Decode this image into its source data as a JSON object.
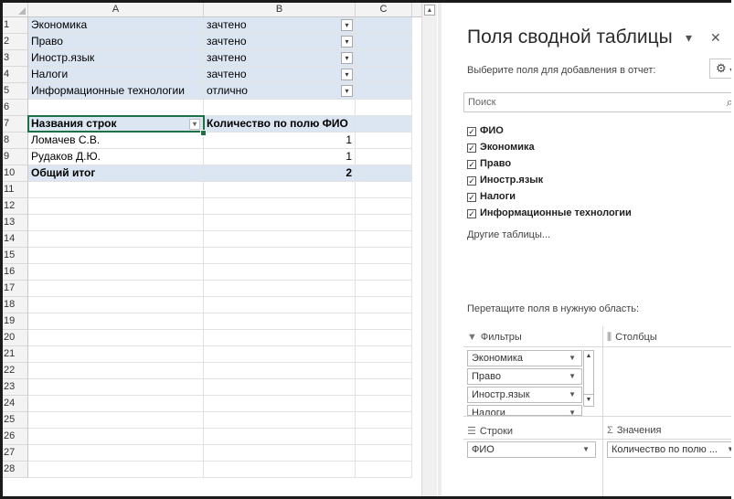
{
  "columns": [
    "A",
    "B",
    "C"
  ],
  "rows": [
    {
      "n": "1",
      "a": "Экономика",
      "b": "зачтено",
      "filter": true
    },
    {
      "n": "2",
      "a": "Право",
      "b": "зачтено",
      "filter": true
    },
    {
      "n": "3",
      "a": "Иностр.язык",
      "b": "зачтено",
      "filter": true
    },
    {
      "n": "4",
      "a": "Налоги",
      "b": "зачтено",
      "filter": true
    },
    {
      "n": "5",
      "a": "Информационные технологии",
      "b": "отлично",
      "filter": true
    },
    {
      "n": "6",
      "a": "",
      "b": ""
    },
    {
      "n": "7",
      "a": "Названия строк",
      "b": "Количество по полю ФИО",
      "header": true
    },
    {
      "n": "8",
      "a": "Ломачев С.В.",
      "b": "1"
    },
    {
      "n": "9",
      "a": "Рудаков Д.Ю.",
      "b": "1"
    },
    {
      "n": "10",
      "a": "Общий итог",
      "b": "2",
      "total": true
    },
    {
      "n": "11"
    },
    {
      "n": "12"
    },
    {
      "n": "13"
    },
    {
      "n": "14"
    },
    {
      "n": "15"
    },
    {
      "n": "16"
    },
    {
      "n": "17"
    },
    {
      "n": "18"
    },
    {
      "n": "19"
    },
    {
      "n": "20"
    },
    {
      "n": "21"
    },
    {
      "n": "22"
    },
    {
      "n": "23"
    },
    {
      "n": "24"
    },
    {
      "n": "25"
    },
    {
      "n": "26"
    },
    {
      "n": "27"
    },
    {
      "n": "28"
    }
  ],
  "pane": {
    "title": "Поля сводной таблицы",
    "choose_label": "Выберите поля для добавления в отчет:",
    "search_placeholder": "Поиск",
    "fields": [
      {
        "label": "ФИО",
        "checked": true,
        "filtered": false
      },
      {
        "label": "Экономика",
        "checked": true,
        "filtered": true
      },
      {
        "label": "Право",
        "checked": true,
        "filtered": true
      },
      {
        "label": "Иностр.язык",
        "checked": true,
        "filtered": true
      },
      {
        "label": "Налоги",
        "checked": true,
        "filtered": true
      },
      {
        "label": "Информационные технологии",
        "checked": true,
        "filtered": true
      }
    ],
    "other_tables": "Другие таблицы...",
    "drag_label": "Перетащите поля в нужную область:",
    "areas": {
      "filters": {
        "label": "Фильтры",
        "items": [
          "Экономика",
          "Право",
          "Иностр.язык",
          "Налоги"
        ]
      },
      "columns": {
        "label": "Столбцы",
        "items": []
      },
      "rows": {
        "label": "Строки",
        "items": [
          "ФИО"
        ]
      },
      "values": {
        "label": "Значения",
        "items": [
          "Количество по полю ..."
        ]
      }
    }
  },
  "colors": {
    "accent": "#1e7145",
    "pivot_blue": "#dce6f2"
  }
}
